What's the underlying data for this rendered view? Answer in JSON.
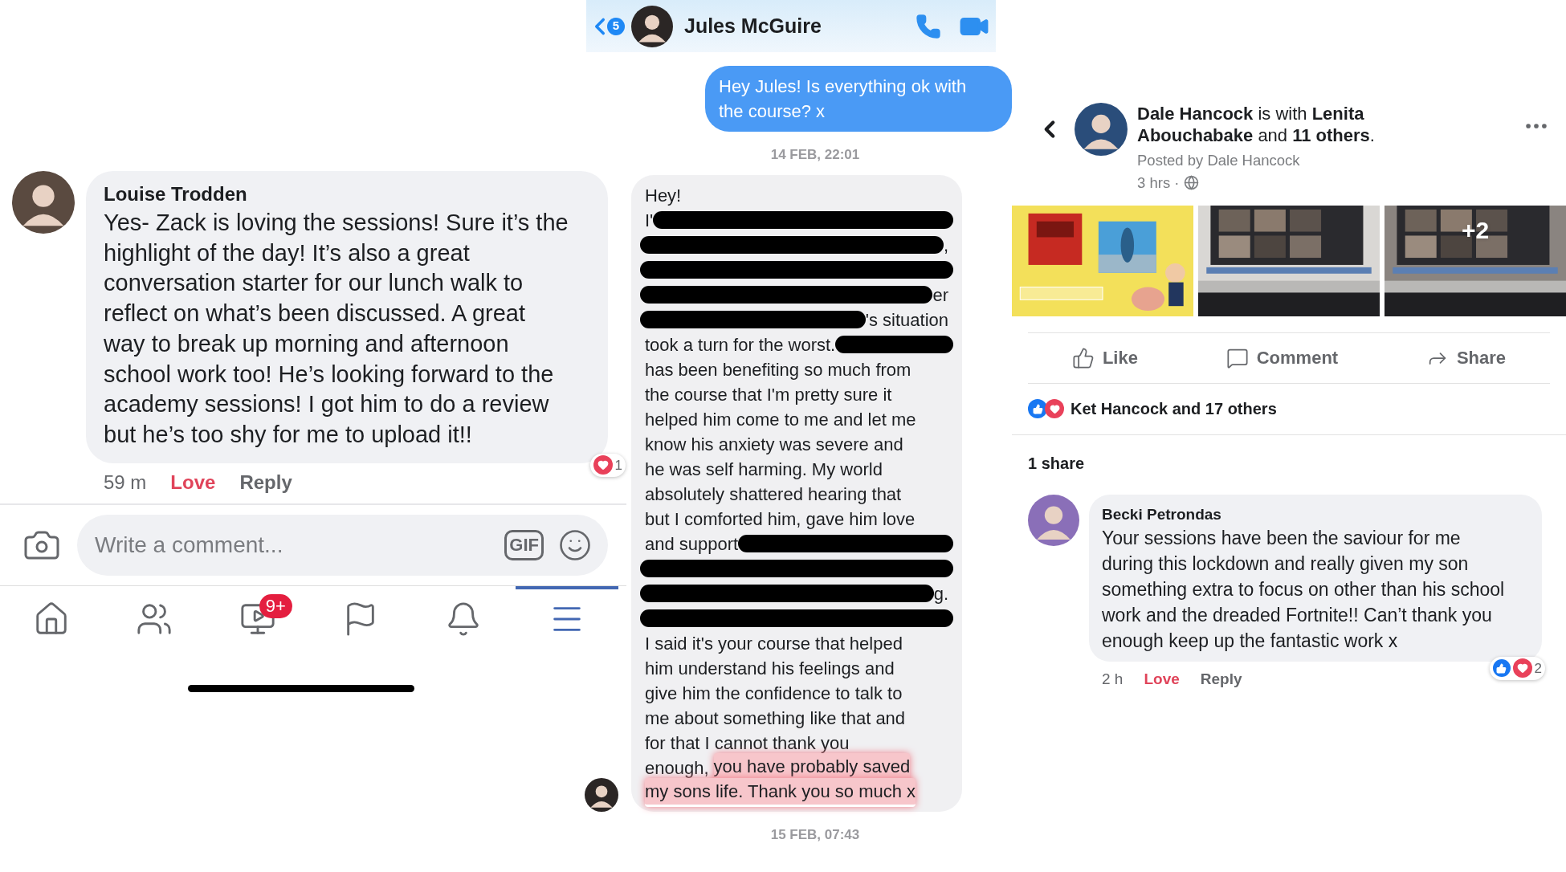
{
  "comment_thread": {
    "comment": {
      "author": "Louise Trodden",
      "text": "Yes- Zack is loving the sessions! Sure it’s the highlight of the day! It’s also a great conversation starter for our lunch walk to reflect on what’s been discussed. A great way to break up morning and afternoon school work too! He’s looking forward to the academy sessions! I got him to do a review but he’s too shy for me to upload it!!",
      "time": "59 m",
      "love_label": "Love",
      "loved": true,
      "reply_label": "Reply",
      "reaction_count": "1"
    },
    "composer": {
      "placeholder": "Write a comment...",
      "gif_label": "GIF"
    },
    "nav_tabs": [
      {
        "selected": false
      },
      {
        "selected": false
      },
      {
        "selected": false,
        "badge": "9+"
      },
      {
        "selected": false
      },
      {
        "selected": false
      },
      {
        "selected": true
      }
    ]
  },
  "chat": {
    "unread_count": "5",
    "contact": "Jules McGuire",
    "items": [
      {
        "kind": "outgoing",
        "text": "Hey Jules! Is everything ok with the course? x"
      },
      {
        "kind": "timestamp",
        "text": "14 FEB, 22:01"
      },
      {
        "kind": "incoming",
        "lines": [
          [
            {
              "kind": "text",
              "text": "Hey!"
            }
          ],
          [
            {
              "kind": "text",
              "text": "I'"
            },
            {
              "kind": "redacted"
            }
          ],
          [
            {
              "kind": "redacted"
            },
            {
              "kind": "text",
              "text": ","
            }
          ],
          [
            {
              "kind": "redacted"
            }
          ],
          [
            {
              "kind": "redacted"
            },
            {
              "kind": "text",
              "text": "er"
            }
          ],
          [
            {
              "kind": "redacted"
            },
            {
              "kind": "text",
              "text": "'s situation"
            }
          ],
          [
            {
              "kind": "text",
              "text": "took a turn for the worst."
            },
            {
              "kind": "redacted"
            }
          ],
          [
            {
              "kind": "text",
              "text": "has been benefiting so much from"
            }
          ],
          [
            {
              "kind": "text",
              "text": "the course that I'm pretty sure it"
            }
          ],
          [
            {
              "kind": "text",
              "text": "helped him come to me and let me"
            }
          ],
          [
            {
              "kind": "text",
              "text": "know his anxiety was severe and"
            }
          ],
          [
            {
              "kind": "text",
              "text": "he was self harming. My world"
            }
          ],
          [
            {
              "kind": "text",
              "text": "absolutely shattered hearing that"
            }
          ],
          [
            {
              "kind": "text",
              "text": "but I comforted him, gave him love"
            }
          ],
          [
            {
              "kind": "text",
              "text": "and support"
            },
            {
              "kind": "redacted"
            }
          ],
          [
            {
              "kind": "redacted"
            }
          ],
          [
            {
              "kind": "redacted"
            },
            {
              "kind": "text",
              "text": "g."
            }
          ],
          [
            {
              "kind": "redacted"
            }
          ],
          [
            {
              "kind": "text",
              "text": "I said it's your course that helped"
            }
          ],
          [
            {
              "kind": "text",
              "text": "him understand his feelings and"
            }
          ],
          [
            {
              "kind": "text",
              "text": "give him the confidence to talk to"
            }
          ],
          [
            {
              "kind": "text",
              "text": "me about something like that and"
            }
          ],
          [
            {
              "kind": "text",
              "text": "for that I cannot thank you"
            }
          ],
          [
            {
              "kind": "text",
              "text": "enough,"
            },
            {
              "kind": "highlighted",
              "text": "you have probably saved"
            }
          ],
          [
            {
              "kind": "highlighted",
              "text": "my sons life. Thank you so much x"
            }
          ]
        ]
      },
      {
        "kind": "timestamp",
        "text": "15 FEB, 07:43"
      }
    ]
  },
  "post": {
    "title": "**Dale Hancock** is with **Lenita Abouchabake** and **11 others**.",
    "posted_by": "Posted by Dale Hancock",
    "time": "3 hrs ·",
    "photos": [
      {
        "kind": "picture"
      },
      {
        "kind": "picture"
      },
      {
        "kind": "picture",
        "more": "+2"
      }
    ],
    "actions": [
      "Like",
      "Comment",
      "Share"
    ],
    "reactions_summary": "Ket Hancock and 17 others",
    "shares": "1 share",
    "comment": {
      "author": "Becki Petrondas",
      "text": "Your sessions have been the saviour for me during this lockdown and really given my son something extra to focus on other than his school work and the dreaded Fortnite!! Can’t thank you enough keep up the fantastic work x",
      "time": "2 h",
      "love_label": "Love",
      "loved": true,
      "reply_label": "Reply",
      "reaction_count": "2"
    }
  }
}
